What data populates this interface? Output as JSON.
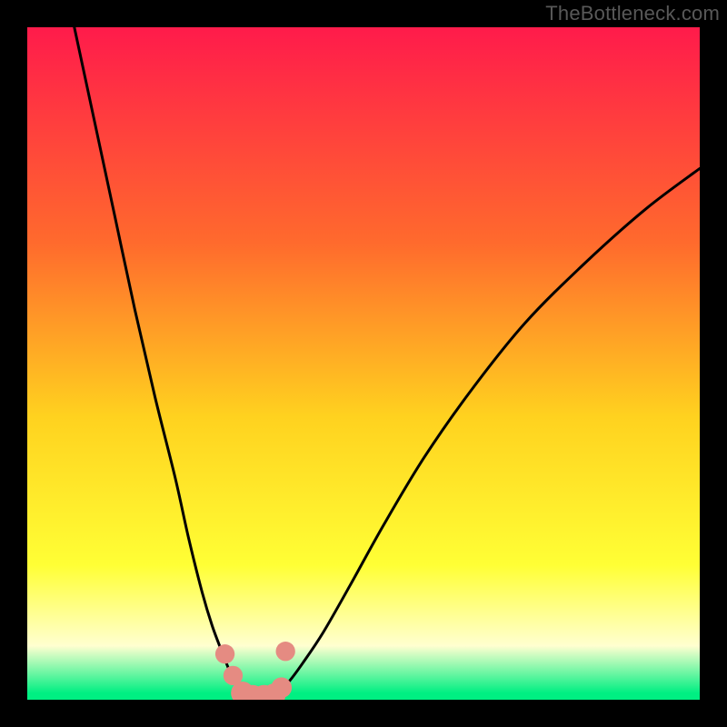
{
  "watermark": "TheBottleneck.com",
  "colors": {
    "frame": "#000000",
    "gradient_top": "#ff1b4b",
    "gradient_mid1": "#ff6a2d",
    "gradient_mid2": "#ffd21f",
    "gradient_mid3": "#ffff35",
    "gradient_pale": "#ffffd0",
    "gradient_green": "#00ef82",
    "curve": "#000000",
    "marker_fill": "#e58b82",
    "marker_stroke": "#c96a60"
  },
  "chart_data": {
    "type": "line",
    "title": "",
    "xlabel": "",
    "ylabel": "",
    "xlim": [
      0,
      100
    ],
    "ylim": [
      0,
      100
    ],
    "series": [
      {
        "name": "left-branch",
        "x": [
          7,
          10,
          13,
          16,
          19,
          22,
          24,
          26,
          27.5,
          29,
          30,
          31,
          31.8
        ],
        "y": [
          100,
          86,
          72,
          58,
          45,
          33,
          24,
          16,
          11,
          7,
          4.5,
          2.5,
          1.3
        ]
      },
      {
        "name": "right-branch",
        "x": [
          37.5,
          39,
          41,
          44,
          48,
          53,
          59,
          66,
          74,
          83,
          92,
          100
        ],
        "y": [
          1.3,
          2.8,
          5.5,
          10,
          17,
          26,
          36,
          46,
          56,
          65,
          73,
          79
        ]
      },
      {
        "name": "valley-floor",
        "x": [
          31.8,
          32.5,
          33.5,
          34.7,
          35.8,
          36.8,
          37.5
        ],
        "y": [
          1.3,
          0.4,
          0,
          0,
          0,
          0.4,
          1.3
        ]
      }
    ],
    "markers": {
      "name": "highlight-points",
      "points": [
        {
          "x": 29.4,
          "y": 6.8,
          "r": 1.0
        },
        {
          "x": 30.6,
          "y": 3.6,
          "r": 1.0
        },
        {
          "x": 32.0,
          "y": 1.0,
          "r": 1.3
        },
        {
          "x": 33.5,
          "y": 0.3,
          "r": 1.5
        },
        {
          "x": 35.2,
          "y": 0.3,
          "r": 1.5
        },
        {
          "x": 36.7,
          "y": 0.7,
          "r": 1.3
        },
        {
          "x": 37.8,
          "y": 1.8,
          "r": 1.1
        },
        {
          "x": 38.4,
          "y": 7.2,
          "r": 1.0
        }
      ]
    }
  }
}
